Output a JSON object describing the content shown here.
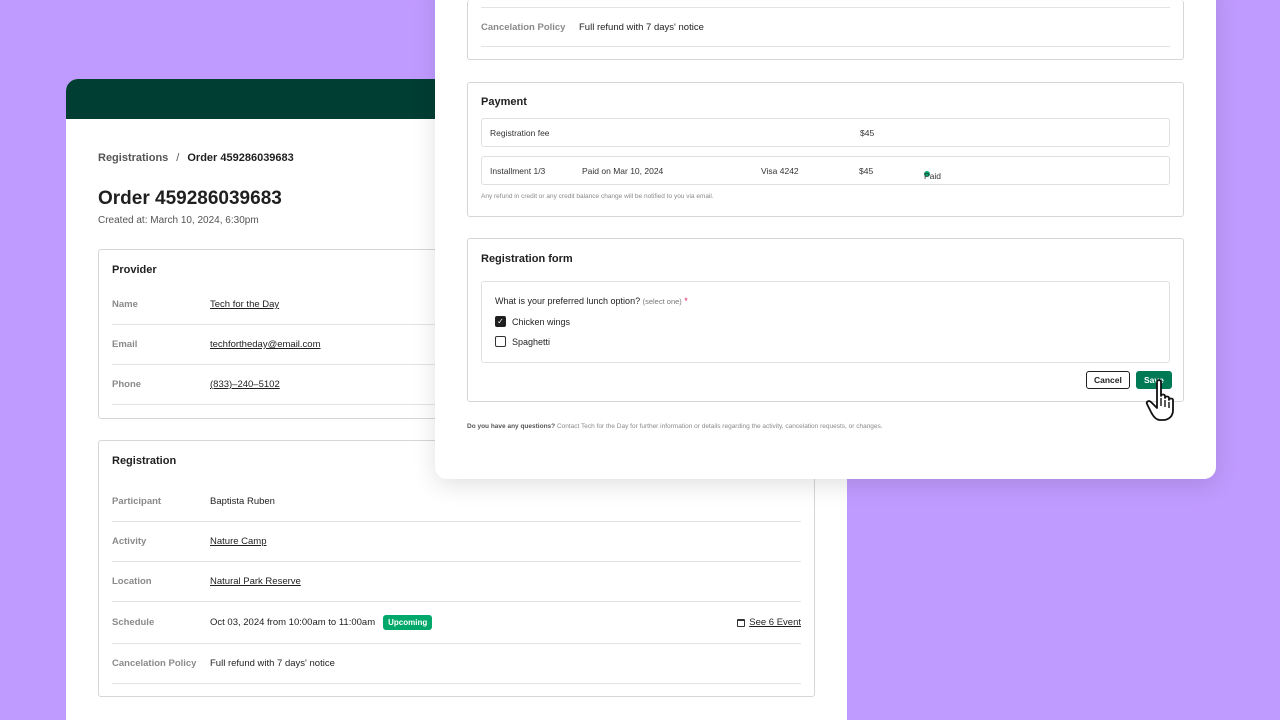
{
  "breadcrumb": {
    "parent": "Registrations",
    "separator": "/",
    "current": "Order 459286039683"
  },
  "order": {
    "title": "Order 459286039683",
    "created": "Created at: March 10, 2024, 6:30pm"
  },
  "provider": {
    "title": "Provider",
    "rows": [
      {
        "label": "Name",
        "value": "Tech for the Day"
      },
      {
        "label": "Email",
        "value": "techfortheday@email.com"
      },
      {
        "label": "Phone",
        "value": "(833)–240–5102"
      }
    ]
  },
  "registration": {
    "title": "Registration",
    "participant_label": "Participant",
    "participant": "Baptista Ruben",
    "activity_label": "Activity",
    "activity": "Nature Camp",
    "location_label": "Location",
    "location": "Natural Park Reserve",
    "schedule_label": "Schedule",
    "schedule": "Oct 03, 2024 from 10:00am to 11:00am",
    "schedule_status": "Upcoming",
    "see_event": "See 6 Event",
    "policy_label": "Cancelation Policy",
    "policy": "Full refund with 7 days' notice"
  },
  "dialog": {
    "policy_label": "Cancelation Policy",
    "policy": "Full refund with 7 days' notice",
    "payment": {
      "title": "Payment",
      "fee_label": "Registration fee",
      "fee_amount": "$45",
      "installment": "Installment 1/3",
      "paid_on": "Paid on Mar 10, 2024",
      "card": "Visa 4242",
      "amount": "$45",
      "status": "Paid",
      "note": "Any refund in credit or any credit balance change will be notified to you via email."
    },
    "form": {
      "title": "Registration form",
      "question": "What is your preferred lunch option?",
      "hint": "(select one)",
      "required": "*",
      "options": [
        {
          "label": "Chicken wings",
          "checked": true
        },
        {
          "label": "Spaghetti",
          "checked": false
        }
      ],
      "cancel": "Cancel",
      "save": "Save"
    },
    "footer_bold": "Do you have any questions?",
    "footer_text": " Contact Tech for the Day for further information or details regarding the activity, cancelation requests, or changes."
  },
  "colors": {
    "background": "#c09bff",
    "header": "#003d33",
    "accent": "#007a55",
    "status_green": "#00a86b"
  }
}
